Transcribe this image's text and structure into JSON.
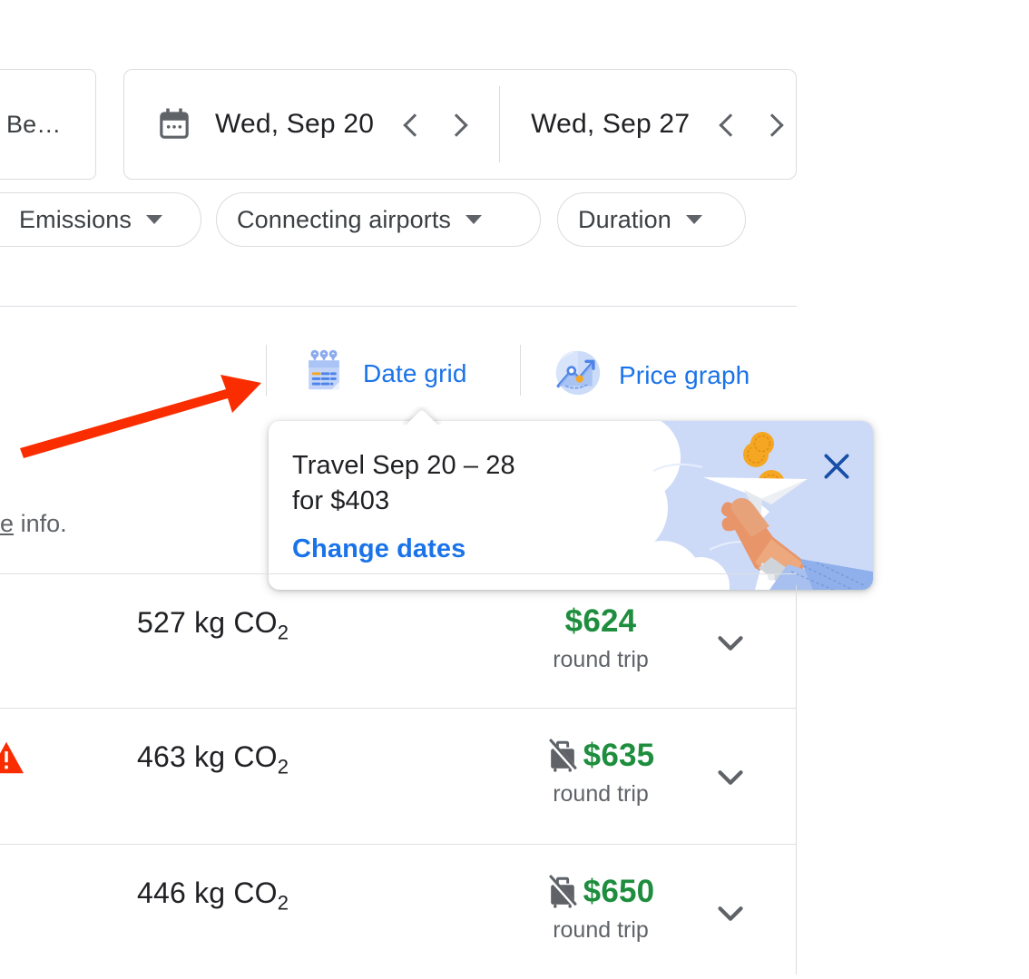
{
  "filters": {
    "origin_chip_label": "Be…",
    "emissions_label": "Emissions",
    "connecting_airports_label": "Connecting airports",
    "duration_label": "Duration"
  },
  "date_range": {
    "calendar_icon": "calendar-icon",
    "depart_date": "Wed, Sep 20",
    "return_date": "Wed, Sep 27",
    "prev_icon": "chevron-left-icon",
    "next_icon": "chevron-right-icon"
  },
  "view_toggle": {
    "date_grid_label": "Date grid",
    "date_grid_icon": "date-grid-icon",
    "price_graph_label": "Price graph",
    "price_graph_icon": "price-graph-icon"
  },
  "promo": {
    "line1": "Travel Sep 20 – 28",
    "line2": "for $403",
    "link": "Change dates",
    "close_icon": "close-icon",
    "illustration": "hand-throwing-paper-plane-with-coins"
  },
  "assistance_note": {
    "link_text": "sistance",
    "rest_text": " info."
  },
  "results": [
    {
      "emissions": "527 kg CO",
      "emissions_sub": "2",
      "price": "$624",
      "trip_type": "round trip",
      "no_bag_icon": false,
      "warning_icon": false
    },
    {
      "emissions": "463 kg CO",
      "emissions_sub": "2",
      "price": "$635",
      "trip_type": "round trip",
      "no_bag_icon": true,
      "warning_icon": true
    },
    {
      "emissions": "446 kg CO",
      "emissions_sub": "2",
      "price": "$650",
      "trip_type": "round trip",
      "no_bag_icon": true,
      "warning_icon": false
    }
  ],
  "colors": {
    "link_blue": "#1a73e8",
    "price_green": "#1e8e3e",
    "annotation_red": "#f92d00",
    "border_grey": "#dadce0",
    "sky_blue": "#ccdaf8"
  },
  "annotation": {
    "arrow": "red-pointer-arrow"
  }
}
